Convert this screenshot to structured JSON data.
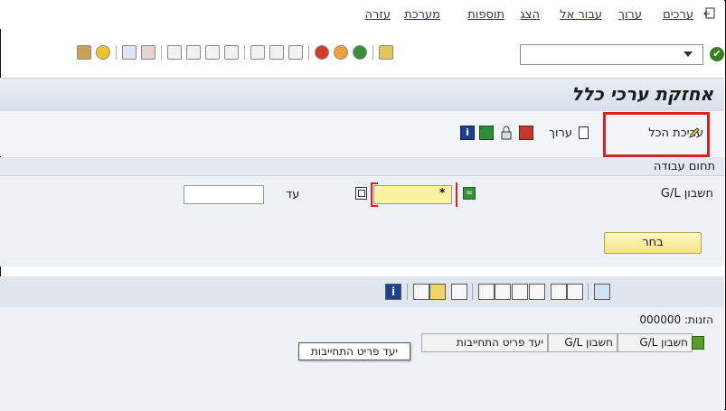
{
  "menu": {
    "items": [
      "ערכים",
      "ערוך",
      "עבור אל",
      "הצג",
      "תוספות",
      "מערכת",
      "עזרה"
    ]
  },
  "toolbar": {
    "command_field_value": ""
  },
  "title": "אחזקת ערכי כלל",
  "app_toolbar": {
    "edit_all_label": "עריכת הכל",
    "edit_label": "ערוך"
  },
  "work_area": {
    "section_title": "תחום עבודה",
    "gl_account_label": "חשבון G/L",
    "from_value": "",
    "to_label": "עד",
    "to_value": "",
    "select_button": "בחר"
  },
  "alv": {
    "postings_label": "הזנות: 000000",
    "columns": [
      "חשבון G/L",
      "חשבון G/L",
      "יעד פריט התחייבות"
    ],
    "tooltip": "יעד פריט התחייבות"
  },
  "colors": {
    "highlight": "#e0201b",
    "required_field": "#fdf29f",
    "title_bar": "#d6dfe9"
  }
}
